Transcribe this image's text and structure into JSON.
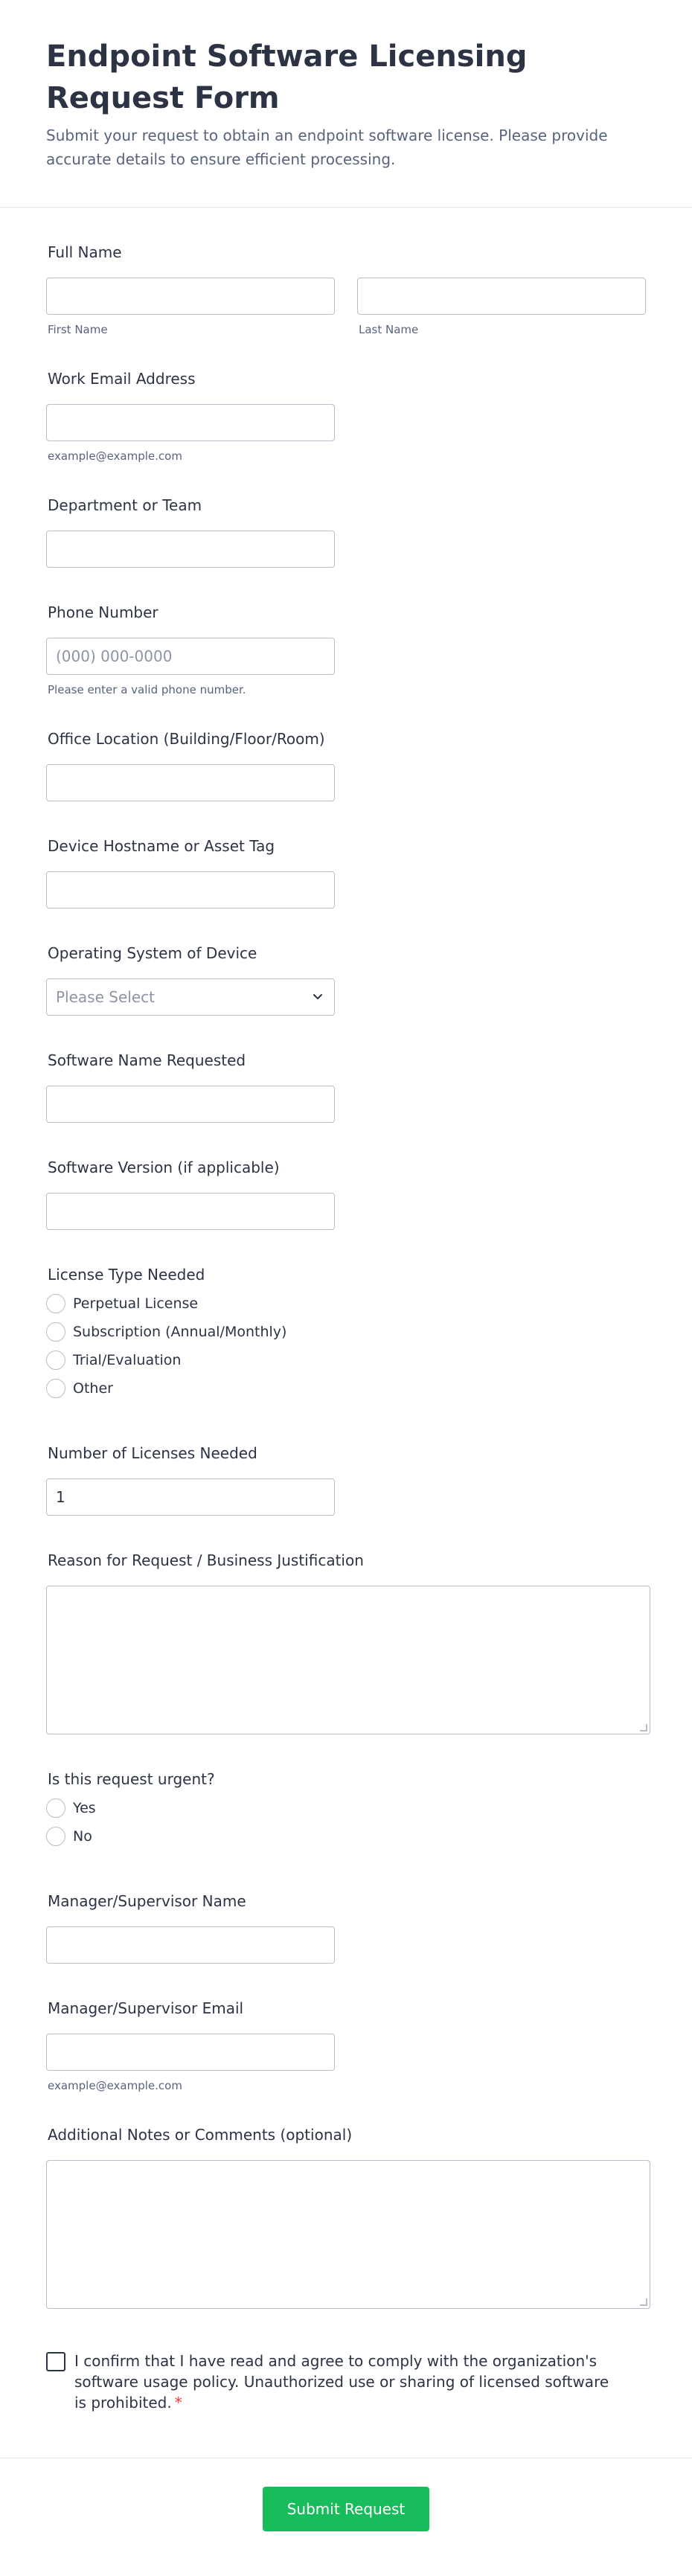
{
  "header": {
    "title": "Endpoint Software Licensing Request Form",
    "subtitle": "Submit your request to obtain an endpoint software license. Please provide accurate details to ensure efficient processing."
  },
  "fields": {
    "full_name": {
      "label": "Full Name",
      "first_sub": "First Name",
      "last_sub": "Last Name",
      "first_value": "",
      "last_value": ""
    },
    "work_email": {
      "label": "Work Email Address",
      "sub": "example@example.com",
      "value": ""
    },
    "department": {
      "label": "Department or Team",
      "value": ""
    },
    "phone": {
      "label": "Phone Number",
      "placeholder": "(000) 000-0000",
      "sub": "Please enter a valid phone number.",
      "value": ""
    },
    "office_location": {
      "label": "Office Location (Building/Floor/Room)",
      "value": ""
    },
    "hostname": {
      "label": "Device Hostname or Asset Tag",
      "value": ""
    },
    "os": {
      "label": "Operating System of Device",
      "selected": "Please Select"
    },
    "software_name": {
      "label": "Software Name Requested",
      "value": ""
    },
    "software_version": {
      "label": "Software Version (if applicable)",
      "value": ""
    },
    "license_type": {
      "label": "License Type Needed",
      "options": [
        "Perpetual License",
        "Subscription (Annual/Monthly)",
        "Trial/Evaluation",
        "Other"
      ]
    },
    "num_licenses": {
      "label": "Number of Licenses Needed",
      "value": "1"
    },
    "reason": {
      "label": "Reason for Request / Business Justification",
      "value": ""
    },
    "urgent": {
      "label": "Is this request urgent?",
      "options": [
        "Yes",
        "No"
      ]
    },
    "manager_name": {
      "label": "Manager/Supervisor Name",
      "value": ""
    },
    "manager_email": {
      "label": "Manager/Supervisor Email",
      "sub": "example@example.com",
      "value": ""
    },
    "notes": {
      "label": "Additional Notes or Comments (optional)",
      "value": ""
    },
    "consent": {
      "text": "I confirm that I have read and agree to comply with the organization's software usage policy. Unauthorized use or sharing of licensed software is prohibited.",
      "required_mark": "*"
    }
  },
  "footer": {
    "submit_label": "Submit Request"
  },
  "colors": {
    "accent": "#18bd5b",
    "text": "#2c3345",
    "muted": "#57647e",
    "border": "#b8bdc9",
    "required": "#f23a3c"
  }
}
